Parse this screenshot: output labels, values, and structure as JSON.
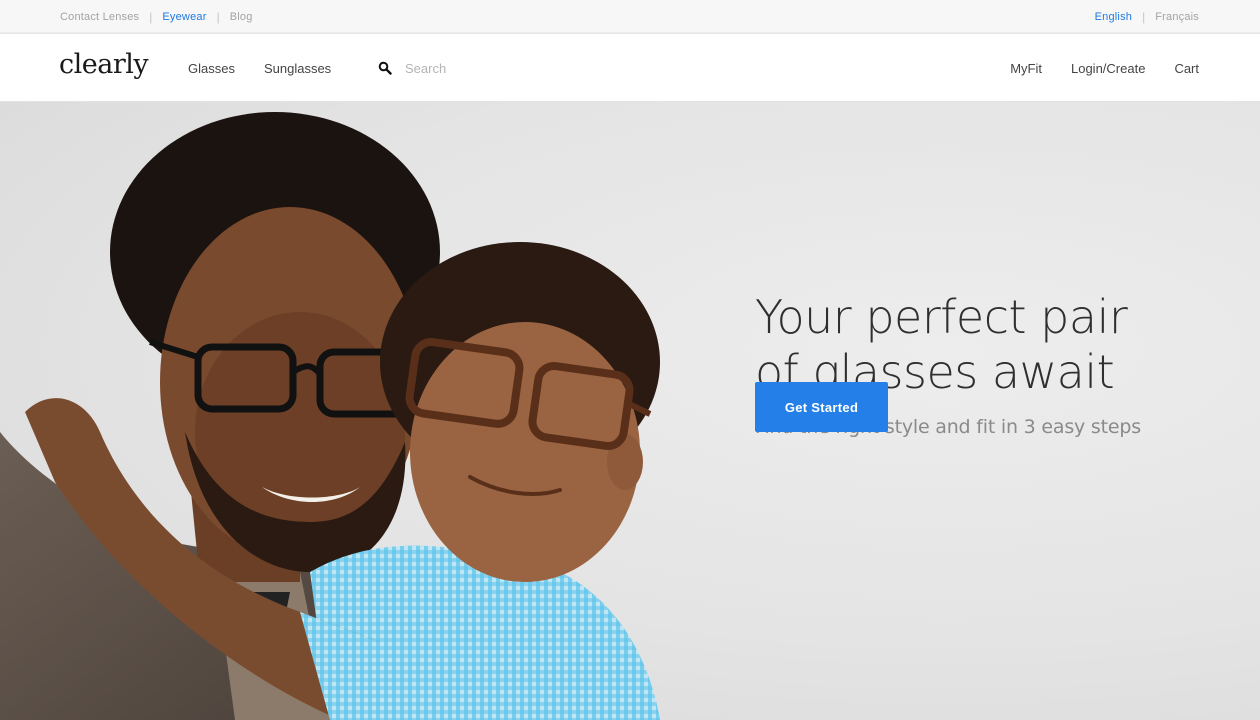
{
  "topbar": {
    "left_links": [
      "Contact Lenses",
      "Eyewear",
      "Blog"
    ],
    "active_left": "Eyewear",
    "languages": [
      "English",
      "Français"
    ],
    "active_language": "English",
    "separator": "|"
  },
  "header": {
    "logo": "clearly",
    "nav": [
      "Glasses",
      "Sunglasses"
    ],
    "search_placeholder": "Search",
    "account_links": [
      "MyFit",
      "Login/Create",
      "Cart"
    ]
  },
  "hero": {
    "headline_line1": "Your perfect pair",
    "headline_line2": "of glasses await",
    "subline": "Find the right style and fit in 3 easy steps",
    "cta_label": "Get Started"
  },
  "colors": {
    "accent": "#2480e8",
    "link_active": "#1f7ae0",
    "hero_bg": "#e6e6e6"
  },
  "icons": {
    "search": "search-icon"
  }
}
